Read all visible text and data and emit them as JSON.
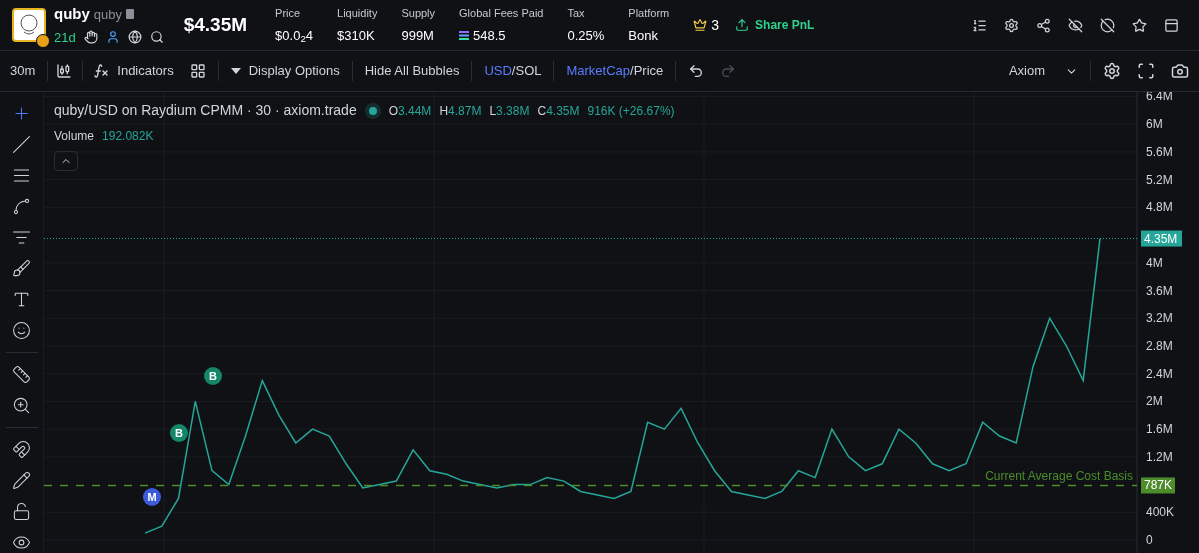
{
  "token": {
    "name": "quby",
    "ticker": "quby",
    "age": "21d",
    "market_cap": "$4.35M"
  },
  "stats": [
    {
      "label": "Price",
      "value": "$0.0$_{2}$4",
      "kind": "plain"
    },
    {
      "label": "Liquidity",
      "value": "$310K",
      "kind": "plain"
    },
    {
      "label": "Supply",
      "value": "999M",
      "kind": "plain"
    },
    {
      "label": "Global Fees Paid",
      "value": "548.5",
      "kind": "sol"
    },
    {
      "label": "Tax",
      "value": "0.25%",
      "kind": "plain"
    },
    {
      "label": "Platform",
      "value": "Bonk",
      "kind": "plain"
    }
  ],
  "crown_count": "3",
  "share_button": "Share PnL",
  "toolbar": {
    "interval": "30m",
    "indicators": "Indicators",
    "display_options": "Display Options",
    "hide_bubbles": "Hide All Bubbles",
    "currency": [
      {
        "label": "USD",
        "selected": true
      },
      {
        "label": "SOL",
        "selected": false
      }
    ],
    "currency_separator": "/",
    "metric": [
      {
        "label": "MarketCap",
        "selected": true
      },
      {
        "label": "Price",
        "selected": false
      }
    ],
    "metric_separator": "/",
    "source": "Axiom"
  },
  "tools": [
    [
      {
        "kind": "crosshair",
        "selected": true
      },
      {
        "kind": "trendline",
        "selected": false
      },
      {
        "kind": "lines",
        "selected": false
      },
      {
        "kind": "pattern",
        "selected": false
      },
      {
        "kind": "fib",
        "selected": false
      },
      {
        "kind": "brush",
        "selected": false
      },
      {
        "kind": "text",
        "selected": false
      },
      {
        "kind": "emoji",
        "selected": false
      }
    ],
    [
      {
        "kind": "ruler",
        "selected": false
      },
      {
        "kind": "zoom",
        "selected": false
      }
    ],
    [
      {
        "kind": "magnet",
        "selected": false
      },
      {
        "kind": "lock-draw",
        "selected": false
      },
      {
        "kind": "lock",
        "selected": false
      },
      {
        "kind": "eye",
        "selected": false
      }
    ]
  ],
  "legend": {
    "title": "quby/USD on Raydium CPMM · 30 · axiom.trade",
    "ohlc": [
      {
        "key": "O",
        "value": "3.44M"
      },
      {
        "key": "H",
        "value": "4.87M"
      },
      {
        "key": "L",
        "value": "3.38M"
      },
      {
        "key": "C",
        "value": "4.35M"
      }
    ],
    "change": "916K (+26.67%)",
    "volume_label": "Volume",
    "volume_value": "192.082K"
  },
  "trade_markers": [
    {
      "label": "M",
      "color": "#3b5bdb"
    },
    {
      "label": "B",
      "color": "#14876b"
    },
    {
      "label": "B",
      "color": "#14876b"
    }
  ],
  "chart_data": {
    "type": "line",
    "grid": true,
    "ylim": [
      0,
      6450000
    ],
    "yticks": [
      {
        "value": 0,
        "label": "0"
      },
      {
        "value": 400000,
        "label": "400K"
      },
      {
        "value": 1200000,
        "label": "1.2M"
      },
      {
        "value": 1600000,
        "label": "1.6M"
      },
      {
        "value": 2000000,
        "label": "2M"
      },
      {
        "value": 2400000,
        "label": "2.4M"
      },
      {
        "value": 2800000,
        "label": "2.8M"
      },
      {
        "value": 3200000,
        "label": "3.2M"
      },
      {
        "value": 3600000,
        "label": "3.6M"
      },
      {
        "value": 4000000,
        "label": "4M"
      },
      {
        "value": 4800000,
        "label": "4.8M"
      },
      {
        "value": 5200000,
        "label": "5.2M"
      },
      {
        "value": 5600000,
        "label": "5.6M"
      },
      {
        "value": 6000000,
        "label": "6M"
      },
      {
        "value": 6400000,
        "label": "6.4M"
      }
    ],
    "values": [
      100000,
      200000,
      600000,
      2000000,
      1000000,
      800000,
      1500000,
      2300000,
      1800000,
      1400000,
      1600000,
      1500000,
      1100000,
      750000,
      800000,
      850000,
      1300000,
      1000000,
      950000,
      850000,
      800000,
      750000,
      800000,
      800000,
      900000,
      850000,
      700000,
      650000,
      600000,
      700000,
      1700000,
      1600000,
      1900000,
      1400000,
      1000000,
      700000,
      650000,
      600000,
      700000,
      1000000,
      900000,
      1600000,
      1200000,
      1000000,
      1100000,
      1600000,
      1400000,
      1100000,
      1000000,
      1100000,
      1700000,
      1500000,
      1400000,
      2500000,
      3200000,
      2800000,
      2300000,
      4350000
    ],
    "ref_lines": [
      {
        "axis": "y",
        "value": 4350000,
        "label": "4.35M",
        "color": "#26a69a"
      },
      {
        "axis": "y",
        "value": 787000,
        "label": "787K",
        "color": "#4c8c2b"
      }
    ],
    "annotations": [
      "Current Average Cost Basis"
    ]
  }
}
